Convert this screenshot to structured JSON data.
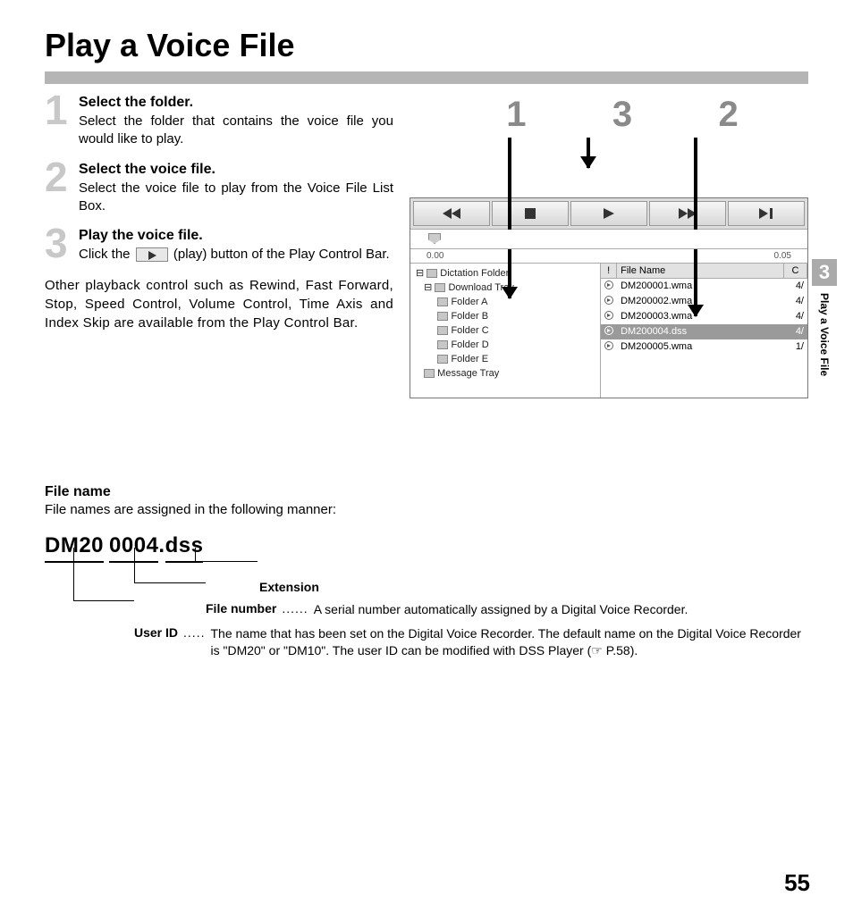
{
  "title": "Play a Voice File",
  "steps": [
    {
      "num": "1",
      "title": "Select the folder.",
      "body": "Select the folder that contains the voice file you would like to play."
    },
    {
      "num": "2",
      "title": "Select the voice file.",
      "body": "Select the voice file to play from the Voice File List Box."
    },
    {
      "num": "3",
      "title": "Play the voice file.",
      "body_before": "Click the ",
      "body_after": " (play) button of the Play Control Bar."
    }
  ],
  "other_text": "Other playback control such as Rewind, Fast Forward, Stop, Speed Control, Volume Control, Time Axis and Index Skip are available from the Play Control Bar.",
  "callouts": {
    "left": "1",
    "mid": "3",
    "right": "2"
  },
  "screenshot": {
    "timeline": {
      "start": "0.00",
      "end": "0.05"
    },
    "tree": {
      "root": "Dictation Folder",
      "download": "Download Tray",
      "folders": [
        "Folder A",
        "Folder B",
        "Folder C",
        "Folder D",
        "Folder E"
      ],
      "message": "Message Tray"
    },
    "list": {
      "header_bang": "!",
      "header_name": "File Name",
      "header_x": "C",
      "rows": [
        {
          "name": "DM200001.wma",
          "x": "4/"
        },
        {
          "name": "DM200002.wma",
          "x": "4/"
        },
        {
          "name": "DM200003.wma",
          "x": "4/"
        },
        {
          "name": "DM200004.dss",
          "x": "4/",
          "selected": true
        },
        {
          "name": "DM200005.wma",
          "x": "1/"
        }
      ]
    }
  },
  "side_tab": {
    "num": "3",
    "text": "Play a Voice File"
  },
  "filename": {
    "heading": "File name",
    "intro": "File names are assigned in the following manner:",
    "seg_user": "DM20",
    "seg_num": "0004",
    "seg_dot": ".",
    "seg_ext": "dss",
    "legend": {
      "ext_label": "Extension",
      "num_label": "File number",
      "num_desc": "A serial number automatically assigned by a Digital Voice Recorder.",
      "user_label": "User ID",
      "user_desc": "The name that has been set on the Digital Voice Recorder. The default name on the Digital Voice Recorder is \"DM20\" or \"DM10\". The user ID can be modified with DSS Player (☞ P.58)."
    }
  },
  "page_number": "55"
}
